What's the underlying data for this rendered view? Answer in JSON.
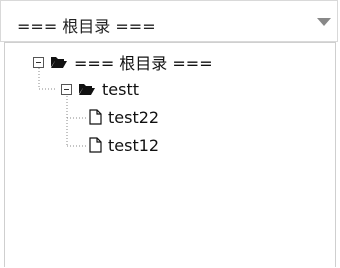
{
  "select": {
    "value": "=== 根目录 ===",
    "caret_icon": "caret-down-icon"
  },
  "tree": {
    "root": {
      "label": "=== 根目录 ===",
      "toggle_icon": "collapse-minus-icon",
      "node_icon": "open-folder-icon",
      "children": [
        {
          "label": "testt",
          "toggle_icon": "collapse-minus-icon",
          "node_icon": "open-folder-icon",
          "children": [
            {
              "label": "test22",
              "node_icon": "file-icon"
            },
            {
              "label": "test12",
              "node_icon": "file-icon"
            }
          ]
        }
      ]
    }
  },
  "colors": {
    "border": "#d9d9d9",
    "text": "#111111",
    "caret": "#888888"
  }
}
